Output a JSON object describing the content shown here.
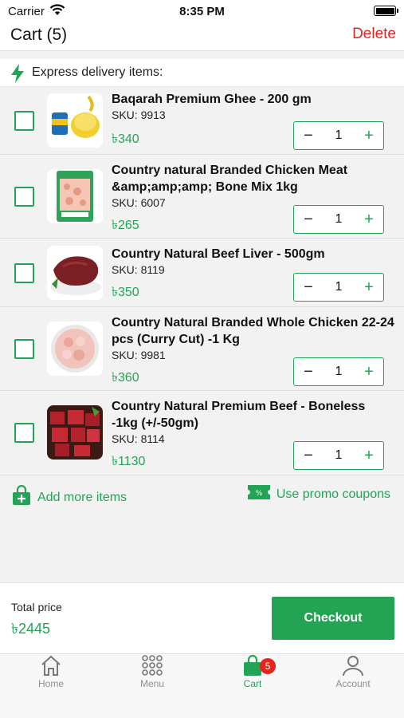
{
  "status_bar": {
    "carrier": "Carrier",
    "time": "8:35 PM"
  },
  "header": {
    "title": "Cart (5)",
    "delete_label": "Delete"
  },
  "express": {
    "label": "Express delivery items:"
  },
  "items": [
    {
      "name": "Baqarah Premium Ghee - 200 gm",
      "sku": "SKU: 9913",
      "price": "৳340",
      "qty": "1",
      "checked": false
    },
    {
      "name": "Country natural Branded Chicken Meat &amp;amp;amp; Bone Mix 1kg",
      "sku": "SKU: 6007",
      "price": "৳265",
      "qty": "1",
      "checked": false
    },
    {
      "name": "Country Natural Beef Liver - 500gm",
      "sku": "SKU: 8119",
      "price": "৳350",
      "qty": "1",
      "checked": false
    },
    {
      "name": "Country Natural Branded Whole Chicken 22-24 pcs (Curry Cut) -1 Kg",
      "sku": "SKU: 9981",
      "price": "৳360",
      "qty": "1",
      "checked": false
    },
    {
      "name": "Country Natural Premium Beef - Boneless -1kg (+/-50gm)",
      "sku": "SKU: 8114",
      "price": "৳1130",
      "qty": "1",
      "checked": false
    }
  ],
  "actions": {
    "add_more": "Add more items",
    "promo": "Use promo coupons"
  },
  "footer": {
    "total_label": "Total price",
    "total_value": "৳2445",
    "checkout_label": "Checkout"
  },
  "tabs": [
    {
      "label": "Home",
      "icon": "home-icon"
    },
    {
      "label": "Menu",
      "icon": "grid-icon"
    },
    {
      "label": "Cart",
      "icon": "cart-icon",
      "badge": "5",
      "active": true
    },
    {
      "label": "Account",
      "icon": "person-icon"
    }
  ],
  "colors": {
    "accent": "#23a455",
    "danger": "#e6241c"
  }
}
